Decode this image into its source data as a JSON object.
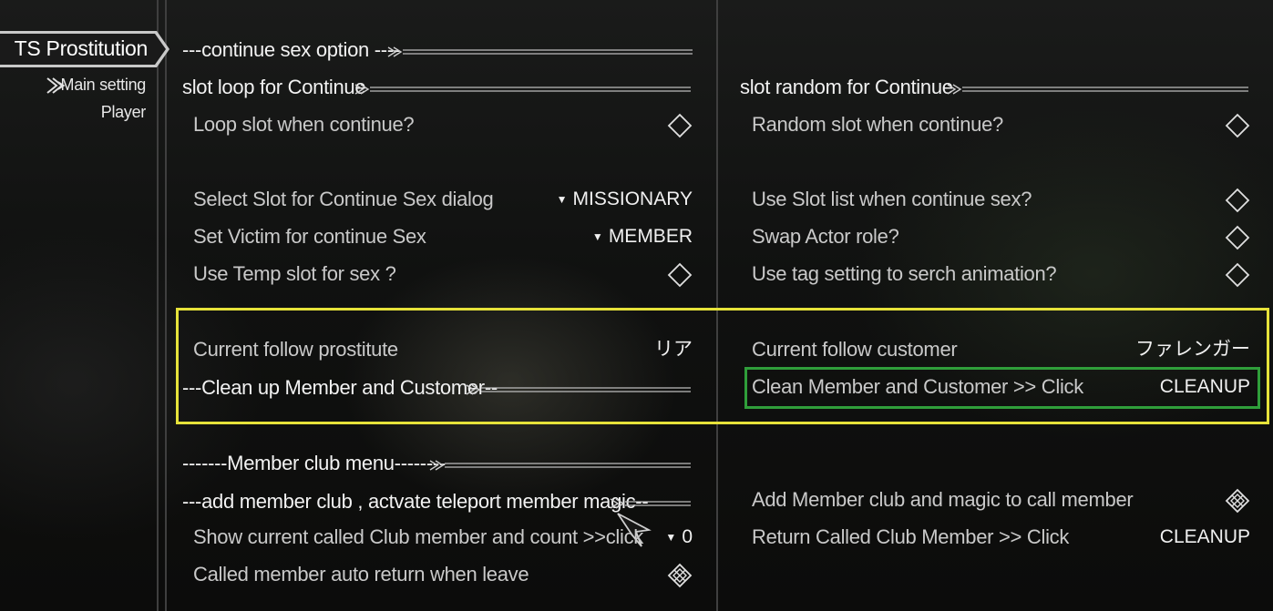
{
  "sidebar": {
    "active_tab": "TS Prostitution",
    "items": [
      {
        "label": "Main setting",
        "icon": "arrow-icon"
      },
      {
        "label": "Player"
      }
    ]
  },
  "left": {
    "header1": "---continue sex option ----",
    "header2": "slot loop for Continue",
    "loop_slot": "Loop slot when continue?",
    "select_slot": "Select Slot for Continue Sex dialog",
    "select_slot_value": "MISSIONARY",
    "set_victim": "Set Victim for continue Sex",
    "set_victim_value": "MEMBER",
    "temp_slot": "Use Temp slot for sex ?",
    "current_prostitute": "Current follow prostitute",
    "current_prostitute_value": "リア",
    "cleanup_header": "---Clean up Member and Customer--",
    "club_header": "-------Member club menu--------",
    "add_club_header": "---add member club , actvate teleport member magic--",
    "show_called": "Show current called Club member and count >>click",
    "show_called_value": "0",
    "auto_return": "Called member auto return when leave"
  },
  "right": {
    "header": "slot random for Continue",
    "random_slot": "Random slot when continue?",
    "use_slot_list": "Use Slot list when continue sex?",
    "swap_actor": "Swap Actor role?",
    "use_tag": "Use tag setting to serch animation?",
    "current_customer": "Current follow customer",
    "current_customer_value": "ファレンガー",
    "clean_member": "Clean Member and Customer >> Click",
    "clean_member_value": "CLEANUP",
    "add_member_club": "Add Member club and magic to call member",
    "return_called": "Return Called Club Member >> Click",
    "return_called_value": "CLEANUP"
  },
  "colors": {
    "highlight_yellow": "#e6e23a",
    "highlight_green": "#2f9e3a",
    "text": "#d8d8d8",
    "header_text": "#f2f2f2"
  }
}
